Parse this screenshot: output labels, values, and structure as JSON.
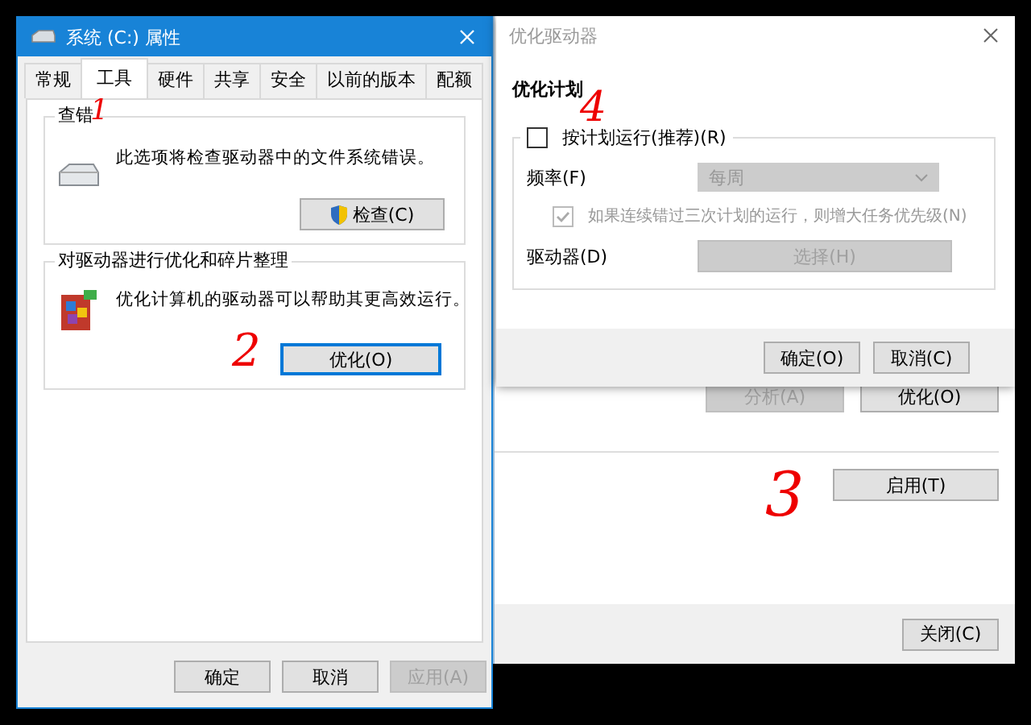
{
  "properties_window": {
    "title": "系统 (C:) 属性",
    "tabs": [
      {
        "label": "常规",
        "selected": false
      },
      {
        "label": "工具",
        "selected": true
      },
      {
        "label": "硬件",
        "selected": false
      },
      {
        "label": "共享",
        "selected": false
      },
      {
        "label": "安全",
        "selected": false
      },
      {
        "label": "以前的版本",
        "selected": false
      },
      {
        "label": "配额",
        "selected": false
      }
    ],
    "groups": [
      {
        "kind": "check",
        "title": "查错",
        "description": "此选项将检查驱动器中的文件系统错误。",
        "button": {
          "label": "检查(C)",
          "focused": false
        }
      },
      {
        "kind": "optimize",
        "title": "对驱动器进行优化和碎片整理",
        "description": "优化计算机的驱动器可以帮助其更高效运行。",
        "button": {
          "label": "优化(O)",
          "focused": true
        }
      }
    ],
    "buttons": [
      {
        "label": "确定",
        "disabled": false
      },
      {
        "label": "取消",
        "disabled": false
      },
      {
        "label": "应用(A)",
        "disabled": true
      }
    ]
  },
  "optimize_window": {
    "buttons": [
      {
        "label": "分析(A)",
        "disabled": true
      },
      {
        "label": "优化(O)",
        "disabled": false
      }
    ],
    "enable_button": "启用(T)",
    "close_button": "关闭(C)"
  },
  "schedule_dialog": {
    "title": "优化驱动器",
    "heading": "优化计划",
    "schedule_checkbox": {
      "label": "按计划运行(推荐)(R)",
      "checked": false,
      "disabled": false
    },
    "frequency_label": "频率(F)",
    "frequency": {
      "value": "每周",
      "disabled": true
    },
    "priority_checkbox": {
      "label": "如果连续错过三次计划的运行，则增大任务优先级(N)",
      "checked": true,
      "disabled": true
    },
    "drives_label": "驱动器(D)",
    "drives_button": {
      "label": "选择(H)",
      "disabled": true
    },
    "buttons": [
      {
        "label": "确定(O)",
        "disabled": false
      },
      {
        "label": "取消(C)",
        "disabled": false
      }
    ]
  },
  "annotations": [
    {
      "text": "1"
    },
    {
      "text": "2"
    },
    {
      "text": "3"
    },
    {
      "text": "4"
    }
  ]
}
